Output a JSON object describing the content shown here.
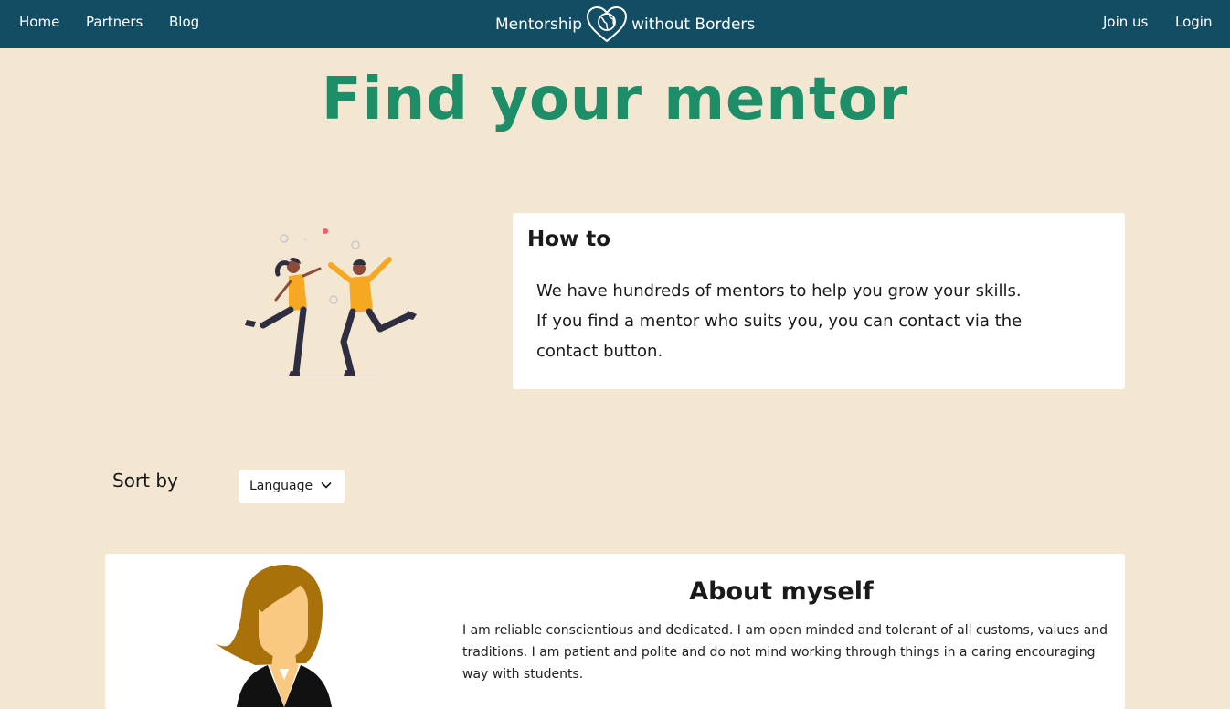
{
  "nav": {
    "home": "Home",
    "partners": "Partners",
    "blog": "Blog",
    "brand_left": "Mentorship",
    "brand_right": "without Borders",
    "join": "Join us",
    "login": "Login"
  },
  "page_title": "Find your mentor",
  "howto": {
    "title": "How to",
    "line1": "We have hundreds of mentors to help you grow your skills.",
    "line2": "If you find a mentor who suits you, you can contact via the",
    "line3": "contact button."
  },
  "sort": {
    "label": "Sort by",
    "selected": "Language"
  },
  "mentor": {
    "about_title": "About myself",
    "about_text": "I am reliable conscientious and dedicated. I am open minded and tolerant of all customs, values and traditions. I am patient and polite and do not mind working through things in a caring encouraging way with students."
  },
  "colors": {
    "navbar": "#134d63",
    "background": "#f3e7d1",
    "title_green": "#1d8e67",
    "accent_yellow": "#f7a823"
  }
}
